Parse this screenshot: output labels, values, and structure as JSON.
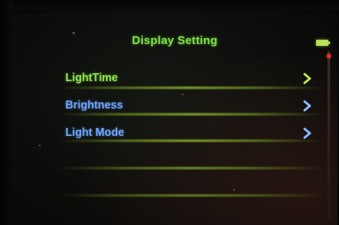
{
  "header": {
    "title": "Display Setting",
    "battery_icon": "battery-icon"
  },
  "colors": {
    "title": "#7fe04a",
    "selected_item": "#8fe84e",
    "item": "#6fa8ff",
    "chevron_selected": "#b7e35a",
    "chevron": "#8ab8ff",
    "scroll_thumb": "#e0322c"
  },
  "menu": {
    "items": [
      {
        "label": "LightTime",
        "selected": true,
        "icon": "chevron-right-icon"
      },
      {
        "label": "Brightness",
        "selected": false,
        "icon": "chevron-right-icon"
      },
      {
        "label": "Light Mode",
        "selected": false,
        "icon": "chevron-right-icon"
      }
    ]
  }
}
